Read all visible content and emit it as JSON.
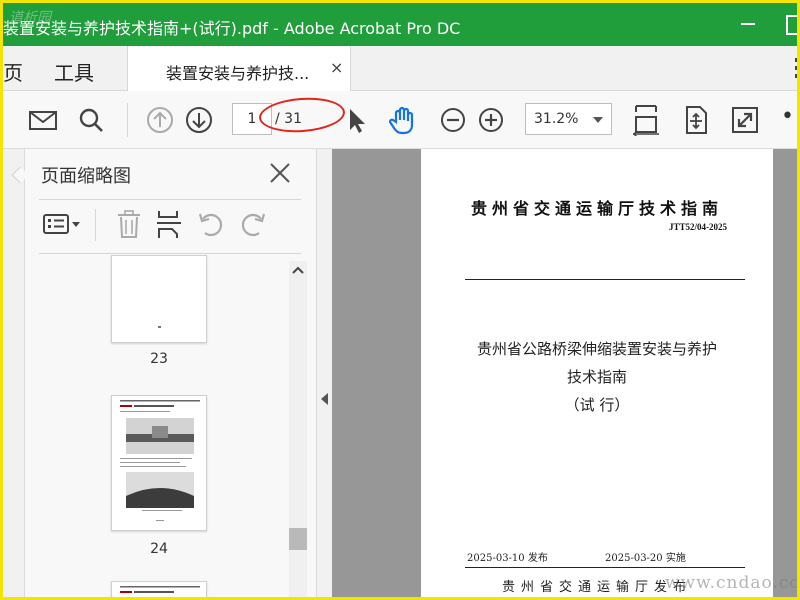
{
  "window": {
    "title": "装置安装与养护技术指南+(试行).pdf - Adobe Acrobat Pro DC"
  },
  "tabs": {
    "home": "页",
    "tools": "工具",
    "document": "装置安装与养护技...",
    "close_glyph": "×"
  },
  "toolbar": {
    "icons": [
      "mail-icon",
      "search-icon",
      "prev-page-icon",
      "next-page-icon",
      "select-arrow-icon",
      "hand-icon",
      "zoom-out-icon",
      "zoom-in-icon",
      "page-display-icon",
      "fit-page-icon",
      "fullscreen-icon",
      "more-icon"
    ],
    "page_current": "1",
    "page_total": "/ 31",
    "zoom": "31.2%",
    "more": "•••"
  },
  "panel": {
    "title": "页面缩略图",
    "tools": [
      "thumbnail-options-icon",
      "delete-icon",
      "insert-page-icon",
      "rotate-ccw-icon",
      "rotate-cw-icon"
    ],
    "thumbnails": [
      {
        "page": "23"
      },
      {
        "page": "24"
      }
    ]
  },
  "document": {
    "org_title": "贵州省交通运输厅技术指南",
    "code": "JTT52/04-2025",
    "main_line1": "贵州省公路桥梁伸缩装置安装与养护",
    "main_line2": "技术指南",
    "main_line3": "（试 行）",
    "publish_date": "2025-03-10 发布",
    "effective_date": "2025-03-20 实施",
    "issuer": "贵州省交通运输厅发布"
  },
  "watermarks": {
    "left": "道析园",
    "right": "www.cndao.cc"
  },
  "colors": {
    "titlebar": "#1f9e3b",
    "frame": "#f2e500",
    "annotation": "#e1251b",
    "hand_tool": "#1473e6"
  }
}
